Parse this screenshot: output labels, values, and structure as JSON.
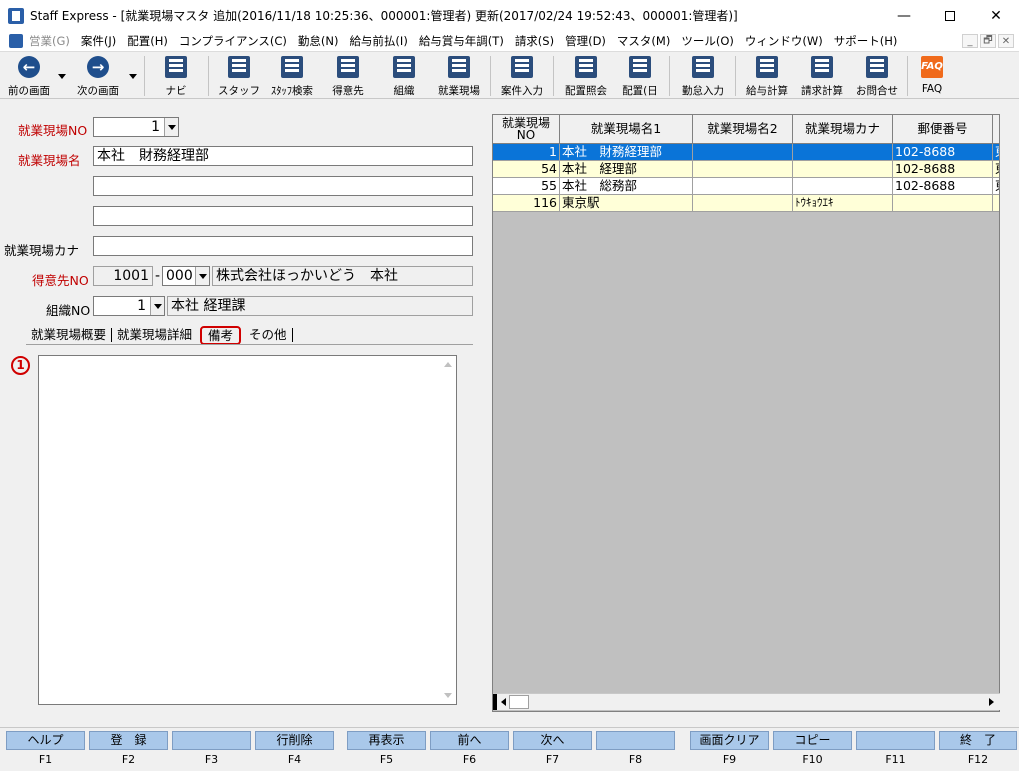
{
  "window": {
    "title": "Staff Express - [就業現場マスタ 追加(2016/11/18 10:25:36、000001:管理者) 更新(2017/02/24 19:52:43、000001:管理者)]",
    "min": "—",
    "close": "✕"
  },
  "menu": [
    {
      "label": "営業(G)",
      "disabled": true
    },
    {
      "label": "案件(J)"
    },
    {
      "label": "配置(H)"
    },
    {
      "label": "コンプライアンス(C)"
    },
    {
      "label": "勤怠(N)"
    },
    {
      "label": "給与前払(I)"
    },
    {
      "label": "給与賞与年調(T)"
    },
    {
      "label": "請求(S)"
    },
    {
      "label": "管理(D)"
    },
    {
      "label": "マスタ(M)"
    },
    {
      "label": "ツール(O)"
    },
    {
      "label": "ウィンドウ(W)"
    },
    {
      "label": "サポート(H)"
    }
  ],
  "mdi_controls": [
    "_",
    "🗗",
    "✕"
  ],
  "toolbar": {
    "back": "前の画面",
    "forward": "次の画面",
    "navi": "ナビ",
    "staff": "スタッフ",
    "staff_search": "ｽﾀｯﾌ検索",
    "client": "得意先",
    "org": "組織",
    "site": "就業現場",
    "case_input": "案件入力",
    "assign_query": "配置照会",
    "assign_day": "配置(日",
    "attendance_input": "勤怠入力",
    "payroll_calc": "給与計算",
    "billing_calc": "請求計算",
    "inquiry": "お問合せ",
    "faq": "FAQ",
    "faq_icon": "FAQ"
  },
  "form": {
    "site_no_label": "就業現場NO",
    "site_no_value": "1",
    "site_name_label": "就業現場名",
    "site_name_1": "本社　財務経理部",
    "site_name_2": "",
    "site_name_3": "",
    "site_kana_label": "就業現場カナ",
    "site_kana_value": "",
    "client_no_label": "得意先NO",
    "client_no": "1001",
    "client_dash": "-",
    "client_branch": "000",
    "client_name": "株式会社ほっかいどう　本社",
    "org_no_label": "組織NO",
    "org_no": "1",
    "org_name": "本社 経理課"
  },
  "tabs": [
    "就業現場概要",
    "就業現場詳細",
    "備考",
    "その他"
  ],
  "active_tab": "備考",
  "marker": "1",
  "memo_value": "",
  "grid": {
    "headers": [
      "就業現場NO",
      "就業現場名1",
      "就業現場名2",
      "就業現場カナ",
      "郵便番号"
    ],
    "rows": [
      {
        "no": "1",
        "name1": "本社　財務経理部",
        "name2": "",
        "kana": "",
        "zip": "102-8688",
        "extra": "東",
        "selected": true
      },
      {
        "no": "54",
        "name1": "本社　経理部",
        "name2": "",
        "kana": "",
        "zip": "102-8688",
        "extra": "東"
      },
      {
        "no": "55",
        "name1": "本社　総務部",
        "name2": "",
        "kana": "",
        "zip": "102-8688",
        "extra": "東"
      },
      {
        "no": "116",
        "name1": "東京駅",
        "name2": "",
        "kana": "ﾄｳｷｮｳｴｷ",
        "zip": "",
        "extra": ""
      }
    ]
  },
  "fkeys": [
    {
      "label": "ヘルプ",
      "key": "F1"
    },
    {
      "label": "登　録",
      "key": "F2"
    },
    {
      "label": "",
      "key": "F3"
    },
    {
      "label": "行削除",
      "key": "F4"
    },
    {
      "label": "再表示",
      "key": "F5"
    },
    {
      "label": "前へ",
      "key": "F6"
    },
    {
      "label": "次へ",
      "key": "F7"
    },
    {
      "label": "",
      "key": "F8"
    },
    {
      "label": "画面クリア",
      "key": "F9"
    },
    {
      "label": "コピー",
      "key": "F10"
    },
    {
      "label": "",
      "key": "F11"
    },
    {
      "label": "終　了",
      "key": "F12"
    }
  ]
}
